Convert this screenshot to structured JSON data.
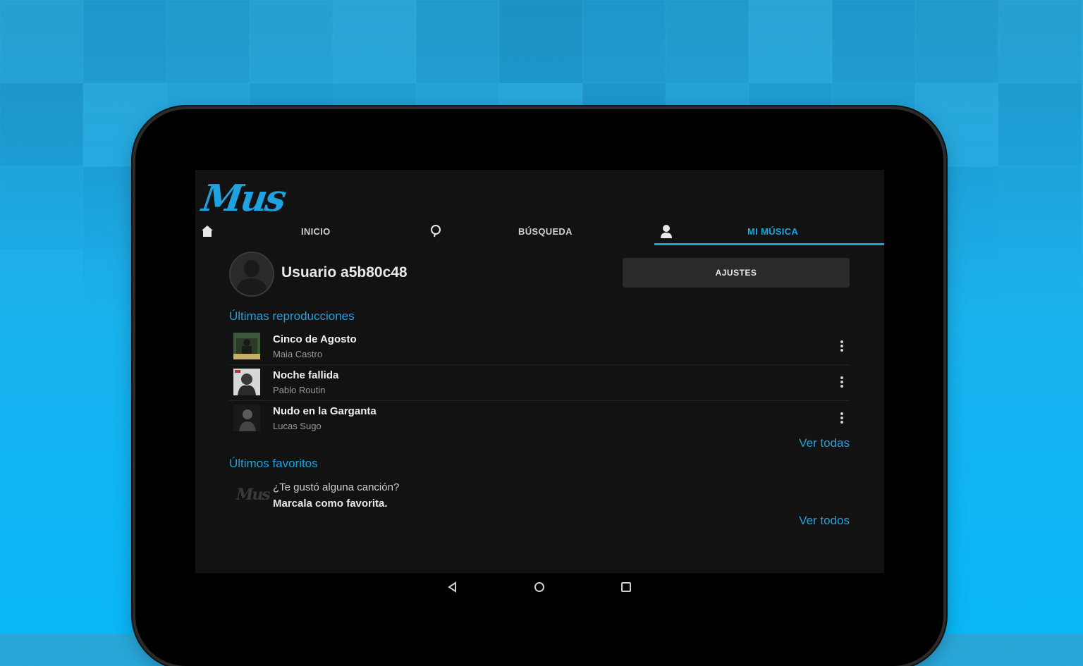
{
  "app": {
    "logo_text": "Mus"
  },
  "tabs": [
    {
      "label": "INICIO",
      "icon": "home-icon"
    },
    {
      "label": "",
      "icon": "search-icon"
    },
    {
      "label": "BÚSQUEDA",
      "icon": ""
    },
    {
      "label": "",
      "icon": "user-icon"
    },
    {
      "label": "MI MÚSICA",
      "icon": ""
    }
  ],
  "profile": {
    "username": "Usuario a5b80c48",
    "settings_label": "AJUSTES"
  },
  "recent": {
    "title": "Últimas reproducciones",
    "tracks": [
      {
        "title": "Cinco de Agosto",
        "artist": "Maia Castro"
      },
      {
        "title": "Noche fallida",
        "artist": "Pablo Routin"
      },
      {
        "title": "Nudo en la Garganta",
        "artist": "Lucas Sugo"
      }
    ],
    "see_all": "Ver todas"
  },
  "favorites": {
    "title": "Últimos favoritos",
    "empty_logo": "Mus",
    "empty_question": "¿Te gustó alguna canción?",
    "empty_hint": "Marcala como favorita.",
    "see_all": "Ver todos"
  },
  "colors": {
    "accent": "#1fa2e0",
    "screen_bg": "#121212",
    "button_bg": "#2a2a2a"
  }
}
